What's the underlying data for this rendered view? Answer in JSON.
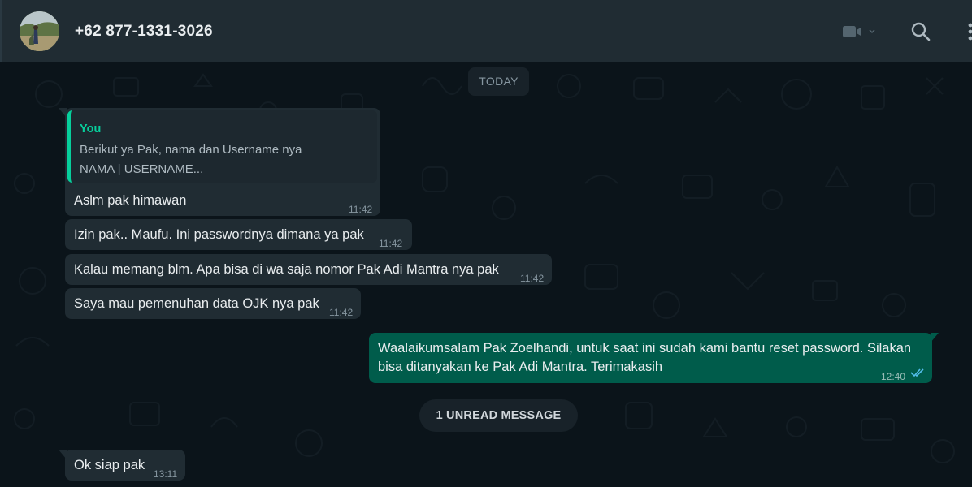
{
  "header": {
    "contact_name": "+62 877-1331-3026",
    "icons": [
      "avatar",
      "video-call-icon",
      "chevron-down-icon",
      "search-icon",
      "more-menu-icon"
    ]
  },
  "chat": {
    "date_divider": "TODAY",
    "unread_divider": "1 UNREAD MESSAGE",
    "quote": {
      "author": "You",
      "line1": "Berikut ya Pak, nama dan Username nya",
      "line2": "NAMA | USERNAME..."
    },
    "messages": [
      {
        "direction": "in",
        "text": "Aslm pak himawan",
        "time": "11:42"
      },
      {
        "direction": "in",
        "text": "Izin pak.. Maufu. Ini passwordnya dimana ya pak",
        "time": "11:42"
      },
      {
        "direction": "in",
        "text": "Kalau memang blm. Apa bisa di wa saja nomor Pak Adi Mantra nya pak",
        "time": "11:42"
      },
      {
        "direction": "in",
        "text": "Saya mau pemenuhan data OJK nya pak",
        "time": "11:42"
      },
      {
        "direction": "out",
        "line1": "Waalaikumsalam Pak Zoelhandi, untuk saat ini sudah kami bantu reset password. Silakan",
        "line2": "bisa ditanyakan ke Pak Adi Mantra. Terimakasih",
        "time": "12:40",
        "status": "read"
      },
      {
        "direction": "in",
        "text": "Ok siap pak",
        "time": "13:11"
      }
    ]
  },
  "colors": {
    "header_bg": "#202c33",
    "chat_bg": "#0b141a",
    "incoming_bubble": "#202c33",
    "outgoing_bubble": "#005c4b",
    "accent_green": "#06cf9c",
    "read_tick": "#53bdeb"
  }
}
